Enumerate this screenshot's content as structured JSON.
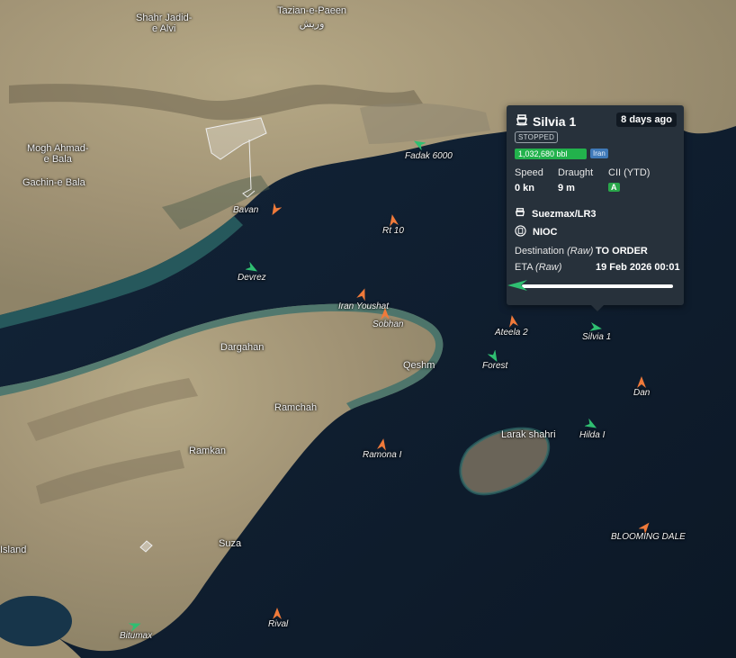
{
  "map": {
    "places": [
      {
        "name": "Tazian-e-Paeen",
        "farsi": "وریش",
        "id": "tazian"
      },
      {
        "name": "Shahr Jadid-\ne Alvi",
        "id": "shahr"
      },
      {
        "name": "Mogh Ahmad-\ne Bala",
        "id": "mogh"
      },
      {
        "name": "Gachin-e Bala",
        "id": "gachin"
      },
      {
        "name": "Dargahan",
        "id": "dargahan"
      },
      {
        "name": "Qeshm",
        "id": "qeshm"
      },
      {
        "name": "Ramchah",
        "id": "ramchah"
      },
      {
        "name": "Ramkan",
        "id": "ramkan"
      },
      {
        "name": "Suza",
        "id": "suza"
      },
      {
        "name": "Island",
        "id": "island"
      },
      {
        "name": "Larak shahri",
        "id": "larak"
      }
    ],
    "vessels": [
      {
        "label": "Fadak 6000",
        "color": "green"
      },
      {
        "label": "Bavan",
        "color": "orange"
      },
      {
        "label": "Rt 10",
        "color": "orange"
      },
      {
        "label": "Devrez",
        "color": "green"
      },
      {
        "label": "Iran Youshat",
        "color": "orange"
      },
      {
        "label": "Sobhan",
        "color": "orange"
      },
      {
        "label": "Ateela 2",
        "color": "orange"
      },
      {
        "label": "Forest",
        "color": "green"
      },
      {
        "label": "Silvia 1",
        "color": "green"
      },
      {
        "label": "Dan",
        "color": "orange"
      },
      {
        "label": "Hilda I",
        "color": "green"
      },
      {
        "label": "Ramona I",
        "color": "orange"
      },
      {
        "label": "BLOOMING DALE",
        "color": "orange"
      },
      {
        "label": "Rival",
        "color": "orange"
      },
      {
        "label": "Bitumax",
        "color": "green"
      }
    ],
    "colors": {
      "orange": "#f07a3a",
      "green": "#2fbf71",
      "water": "#0f1d2e",
      "land": "#a79a7a"
    }
  },
  "popup": {
    "vessel_name": "Silvia 1",
    "age": "8 days ago",
    "status": "STOPPED",
    "capacity": "1,032,680  bbl",
    "flag": "Iran",
    "speed_label": "Speed",
    "speed_value": "0 kn",
    "draught_label": "Draught",
    "draught_value": "9 m",
    "cii_label": "CII (YTD)",
    "cii_value": "A",
    "vessel_class": "Suezmax/LR3",
    "owner": "NIOC",
    "destination_label": "Destination",
    "raw": "(Raw)",
    "destination_value": "TO ORDER",
    "eta_label": "ETA",
    "eta_value": "19 Feb 2026 00:01",
    "progress": 0.0
  }
}
